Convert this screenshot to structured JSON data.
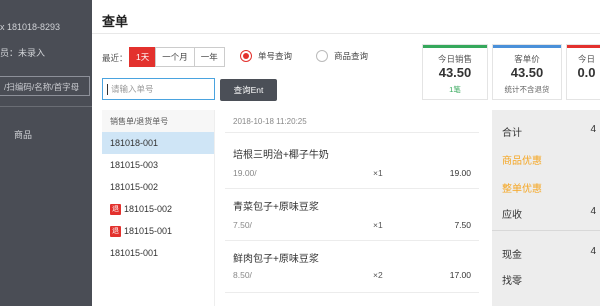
{
  "background": {
    "order_line": "x 181018-8293",
    "member_line": "员：未录入",
    "input_hint": "/扫编码/名称/首字母",
    "col_label": "商品"
  },
  "modal": {
    "title": "查单",
    "range_label": "最近：",
    "ranges": [
      "1天",
      "一个月",
      "一年"
    ],
    "radio_order": "单号查询",
    "radio_product": "商品查询",
    "search_placeholder": "请输入单号",
    "search_button": "查询Ent"
  },
  "stats": [
    {
      "label": "今日销售",
      "value": "43.50",
      "sub": "1笔",
      "color": "#35a85b"
    },
    {
      "label": "客单价",
      "value": "43.50",
      "sub": "统计不含退货",
      "color": "#4a90d9"
    },
    {
      "label": "今日",
      "value": "0.0",
      "sub": "",
      "color": "#e3312d"
    }
  ],
  "order_list": {
    "header": "销售单/退货单号",
    "items": [
      {
        "id": "181018-001",
        "refund": false,
        "selected": true
      },
      {
        "id": "181015-003",
        "refund": false,
        "selected": false
      },
      {
        "id": "181015-002",
        "refund": false,
        "selected": false
      },
      {
        "id": "181015-002",
        "refund": true,
        "selected": false
      },
      {
        "id": "181015-001",
        "refund": true,
        "selected": false
      },
      {
        "id": "181015-001",
        "refund": false,
        "selected": false
      }
    ],
    "refund_tag": "退"
  },
  "detail": {
    "time": "2018-10-18 11:20:25",
    "products": [
      {
        "name": "培根三明治+椰子牛奶",
        "price": "19.00/",
        "qty": "×1",
        "subtotal": "19.00"
      },
      {
        "name": "青菜包子+原味豆浆",
        "price": "7.50/",
        "qty": "×1",
        "subtotal": "7.50"
      },
      {
        "name": "鲜肉包子+原味豆浆",
        "price": "8.50/",
        "qty": "×2",
        "subtotal": "17.00"
      }
    ]
  },
  "summary": {
    "total_label": "合计",
    "total_value": "4",
    "product_discount": "商品优惠",
    "order_discount": "整单优惠",
    "receivable_label": "应收",
    "receivable_value": "4",
    "cash_label": "现金",
    "cash_value": "4",
    "change_label": "找零",
    "change_value": ""
  }
}
